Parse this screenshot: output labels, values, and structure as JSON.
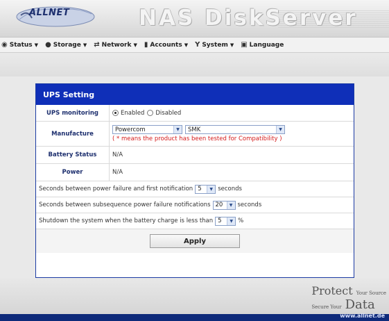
{
  "header": {
    "logo_text": "ALLNET",
    "title": "NAS DiskServer"
  },
  "menu": [
    {
      "label": "Status",
      "icon": "eye-icon"
    },
    {
      "label": "Storage",
      "icon": "storage-icon"
    },
    {
      "label": "Network",
      "icon": "network-icon"
    },
    {
      "label": "Accounts",
      "icon": "accounts-icon"
    },
    {
      "label": "System",
      "icon": "system-icon"
    },
    {
      "label": "Language",
      "icon": "language-icon"
    }
  ],
  "panel": {
    "title": "UPS Setting",
    "ups_monitoring": {
      "label": "UPS monitoring",
      "enabled_label": "Enabled",
      "disabled_label": "Disabled",
      "selected": "Enabled"
    },
    "manufacture": {
      "label": "Manufacture",
      "brand_value": "Powercom",
      "model_value": "SMK",
      "note": "( * means the product has been tested for Compatibility )"
    },
    "battery_status": {
      "label": "Battery Status",
      "value": "N/A"
    },
    "power": {
      "label": "Power",
      "value": "N/A"
    },
    "notify_first": {
      "text": "Seconds between power failure and first notification",
      "value": "5",
      "unit": "seconds"
    },
    "notify_subsequent": {
      "text": "Seconds between subsequence power failure notifications",
      "value": "20",
      "unit": "seconds"
    },
    "shutdown": {
      "text": "Shutdown the system when the battery charge is less than",
      "value": "5",
      "unit": "%"
    },
    "apply_label": "Apply"
  },
  "footer": {
    "protect_line1": "Protect",
    "your_source": "Your Source",
    "secure_your": "Secure Your",
    "data_word": "Data",
    "url": "www.allnet.de"
  },
  "colors": {
    "accent": "#0f2fb8",
    "note": "#d41a1a",
    "label": "#1d2f6e"
  }
}
